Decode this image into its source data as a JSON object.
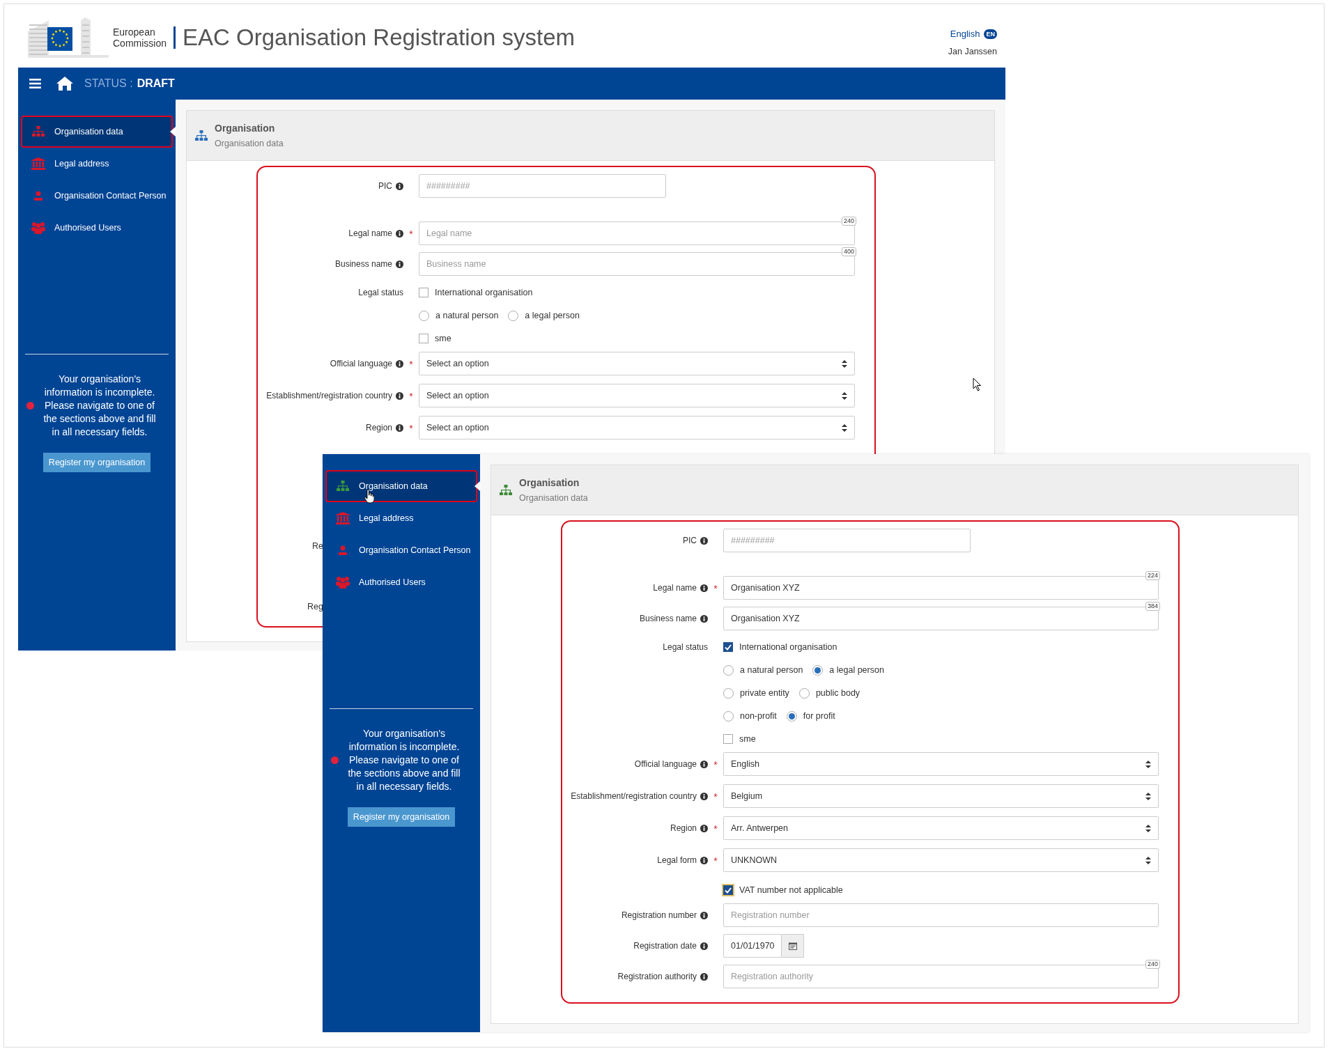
{
  "windows": [
    {
      "header": {
        "logo_lines": [
          "European",
          "Commission"
        ],
        "title": "EAC Organisation Registration system",
        "language": "English",
        "language_badge": "EN",
        "user": "Jan Janssen"
      },
      "navbar": {
        "status_label": "STATUS :",
        "status_value": "DRAFT"
      },
      "sidebar": {
        "items": [
          {
            "kind": "org",
            "label": "Organisation data",
            "selected": true,
            "hovered": false
          },
          {
            "kind": "bank",
            "label": "Legal address",
            "selected": false,
            "hovered": false
          },
          {
            "kind": "person",
            "label": "Organisation Contact Person",
            "selected": false,
            "hovered": false
          },
          {
            "kind": "users",
            "label": "Authorised Users",
            "selected": false,
            "hovered": false
          }
        ],
        "message": "Your organisation's information is incomplete. Please navigate to one of the sections above and fill in all necessary fields.",
        "button": "Register my organisation"
      },
      "panel": {
        "title": "Organisation",
        "subtitle": "Organisation data",
        "color": "#2a6ebb"
      },
      "fields": [
        {
          "kind": "short",
          "label": "PIC",
          "info": true,
          "placeholder": "#########"
        },
        {
          "kind": "text",
          "label": "Legal name",
          "info": true,
          "required_mark": "*",
          "placeholder": "Legal name",
          "counter": "240"
        },
        {
          "kind": "text",
          "label": "Business name",
          "info": true,
          "placeholder": "Business name",
          "counter": "400"
        },
        {
          "kind": "checks",
          "label": "Legal status",
          "options": [
            {
              "label": "International organisation",
              "checked": false
            }
          ]
        },
        {
          "kind": "radios",
          "options": [
            {
              "label": "a natural person",
              "selected": false
            },
            {
              "label": "a legal person",
              "selected": false
            }
          ]
        },
        {
          "kind": "checks",
          "options": [
            {
              "label": "sme",
              "checked": false
            }
          ]
        },
        {
          "kind": "select",
          "label": "Official language",
          "info": true,
          "required_mark": "*",
          "value": "Select an option"
        },
        {
          "kind": "select",
          "label": "Establishment/registration country",
          "info": true,
          "required_mark": "*",
          "value": "Select an option"
        },
        {
          "kind": "select",
          "label": "Region",
          "info": true,
          "required_mark": "*",
          "value": "Select an option"
        },
        {
          "kind": "cut",
          "label": "Re"
        },
        {
          "kind": "cut",
          "label": "Reg"
        }
      ]
    },
    {
      "sidebar": {
        "items": [
          {
            "kind": "org",
            "label": "Organisation data",
            "selected": true,
            "hovered": true
          },
          {
            "kind": "bank",
            "label": "Legal address",
            "selected": false,
            "hovered": false
          },
          {
            "kind": "person",
            "label": "Organisation Contact Person",
            "selected": false,
            "hovered": false
          },
          {
            "kind": "users",
            "label": "Authorised Users",
            "selected": false,
            "hovered": false
          }
        ],
        "message": "Your organisation's information is incomplete. Please navigate to one of the sections above and fill in all necessary fields.",
        "button": "Register my organisation"
      },
      "panel": {
        "title": "Organisation",
        "subtitle": "Organisation data",
        "color": "#3d8b37"
      },
      "fields": [
        {
          "kind": "short",
          "label": "PIC",
          "info": true,
          "placeholder": "#########"
        },
        {
          "kind": "text",
          "label": "Legal name",
          "info": true,
          "required_mark": "*",
          "value": "Organisation XYZ",
          "counter": "224"
        },
        {
          "kind": "text",
          "label": "Business name",
          "info": true,
          "value": "Organisation XYZ",
          "counter": "384"
        },
        {
          "kind": "checks",
          "label": "Legal status",
          "options": [
            {
              "label": "International organisation",
              "checked": true
            }
          ]
        },
        {
          "kind": "radios",
          "options": [
            {
              "label": "a natural person",
              "selected": false
            },
            {
              "label": "a legal person",
              "selected": true
            }
          ]
        },
        {
          "kind": "radios",
          "options": [
            {
              "label": "private entity",
              "selected": false
            },
            {
              "label": "public body",
              "selected": false
            }
          ]
        },
        {
          "kind": "radios",
          "options": [
            {
              "label": "non-profit",
              "selected": false
            },
            {
              "label": "for profit",
              "selected": true
            }
          ]
        },
        {
          "kind": "checks",
          "options": [
            {
              "label": "sme",
              "checked": false
            }
          ]
        },
        {
          "kind": "select",
          "label": "Official language",
          "info": true,
          "required_mark": "*",
          "value": "English"
        },
        {
          "kind": "select",
          "label": "Establishment/registration country",
          "info": true,
          "required_mark": "*",
          "value": "Belgium"
        },
        {
          "kind": "select",
          "label": "Region",
          "info": true,
          "required_mark": "*",
          "value": "Arr. Antwerpen"
        },
        {
          "kind": "select",
          "label": "Legal form",
          "info": true,
          "required_mark": "*",
          "value": "UNKNOWN"
        },
        {
          "kind": "checks",
          "options": [
            {
              "label": "VAT number not applicable",
              "checked": true,
              "focused": true
            }
          ]
        },
        {
          "kind": "text",
          "label": "Registration number",
          "info": true,
          "placeholder": "Registration number"
        },
        {
          "kind": "date",
          "label": "Registration date",
          "info": true,
          "value": "01/01/1970"
        },
        {
          "kind": "text",
          "label": "Registration authority",
          "info": true,
          "placeholder": "Registration authority",
          "counter": "240"
        }
      ]
    }
  ]
}
